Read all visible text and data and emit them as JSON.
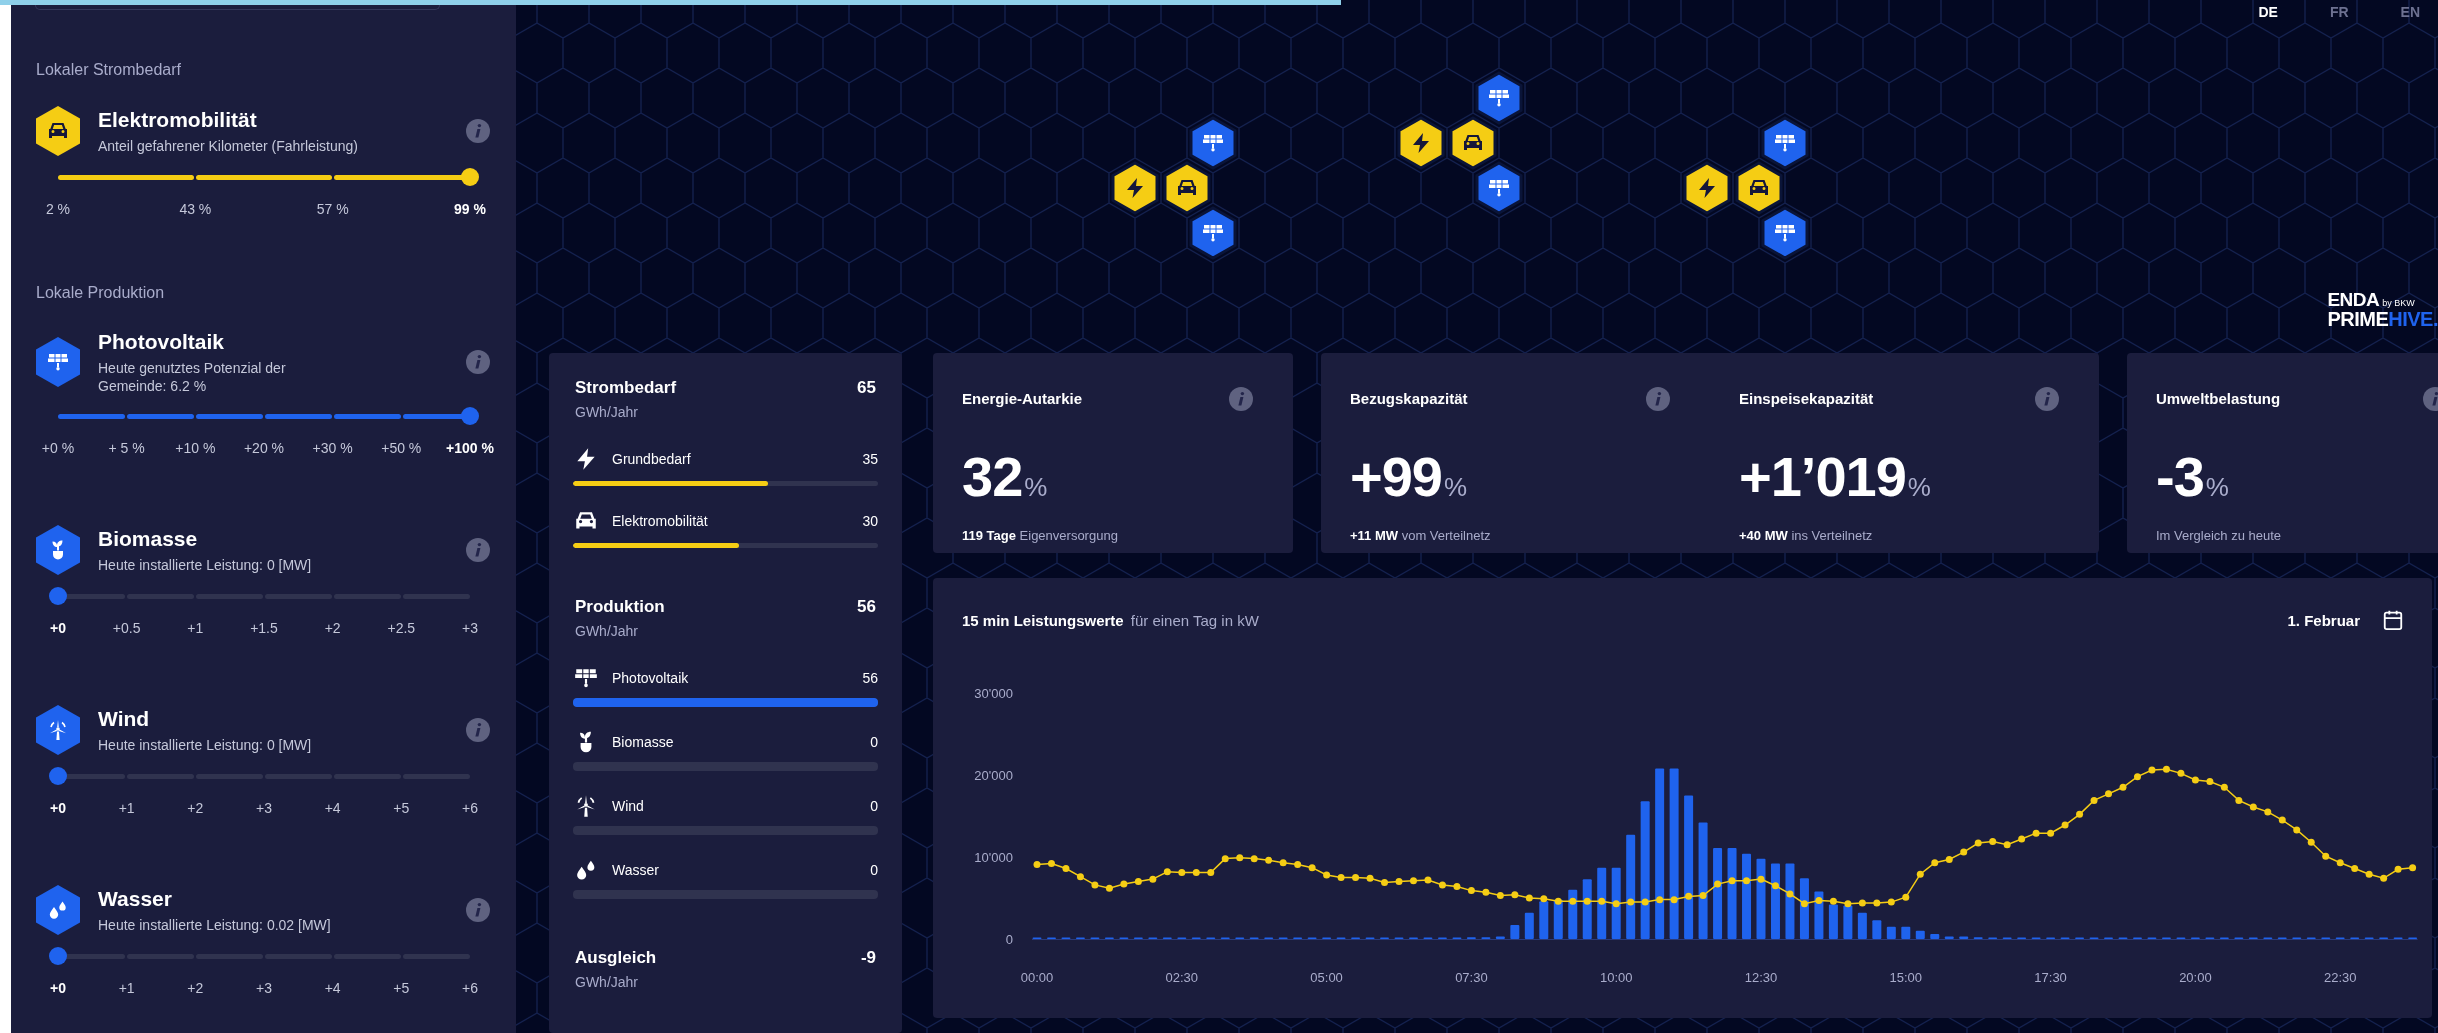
{
  "loading_bar": {
    "level": 0.55
  },
  "sidebar": {
    "sections": [
      {
        "kind": "demand",
        "heading": "Lokaler Strombedarf",
        "controls": [
          {
            "kind": "car",
            "title": "Elektromobilität",
            "subtitle": "Anteil gefahrener Kilometer (Fahrleistung)",
            "level": 1,
            "ticks": [
              {
                "label": "2 %",
                "selected": false
              },
              {
                "label": "43 %",
                "selected": false
              },
              {
                "label": "57 %",
                "selected": false
              },
              {
                "label": "99 %",
                "selected": true
              }
            ]
          }
        ]
      },
      {
        "kind": "production",
        "heading": "Lokale Produktion",
        "controls": [
          {
            "kind": "solar",
            "title": "Photovoltaik",
            "subtitle": "Heute genutztes Potenzial der\nGemeinde: 6.2 %",
            "level": 1,
            "ticks": [
              {
                "label": "+0 %",
                "selected": false
              },
              {
                "label": "+ 5 %",
                "selected": false
              },
              {
                "label": "+10 %",
                "selected": false
              },
              {
                "label": "+20 %",
                "selected": false
              },
              {
                "label": "+30 %",
                "selected": false
              },
              {
                "label": "+50 %",
                "selected": false
              },
              {
                "label": "+100 %",
                "selected": true
              }
            ]
          },
          {
            "kind": "sprout",
            "title": "Biomasse",
            "subtitle": "Heute installierte Leistung: 0 [MW]",
            "level": 0,
            "ticks": [
              {
                "label": "+0",
                "selected": true
              },
              {
                "label": "+0.5",
                "selected": false
              },
              {
                "label": "+1",
                "selected": false
              },
              {
                "label": "+1.5",
                "selected": false
              },
              {
                "label": "+2",
                "selected": false
              },
              {
                "label": "+2.5",
                "selected": false
              },
              {
                "label": "+3",
                "selected": false
              }
            ]
          },
          {
            "kind": "turbine",
            "title": "Wind",
            "subtitle": "Heute installierte Leistung: 0 [MW]",
            "level": 0,
            "ticks": [
              {
                "label": "+0",
                "selected": true
              },
              {
                "label": "+1",
                "selected": false
              },
              {
                "label": "+2",
                "selected": false
              },
              {
                "label": "+3",
                "selected": false
              },
              {
                "label": "+4",
                "selected": false
              },
              {
                "label": "+5",
                "selected": false
              },
              {
                "label": "+6",
                "selected": false
              }
            ]
          },
          {
            "kind": "drops",
            "title": "Wasser",
            "subtitle": "Heute installierte Leistung: 0.02 [MW]",
            "level": 0,
            "ticks": [
              {
                "label": "+0",
                "selected": true
              },
              {
                "label": "+1",
                "selected": false
              },
              {
                "label": "+2",
                "selected": false
              },
              {
                "label": "+3",
                "selected": false
              },
              {
                "label": "+4",
                "selected": false
              },
              {
                "label": "+5",
                "selected": false
              },
              {
                "label": "+6",
                "selected": false
              }
            ]
          }
        ]
      }
    ]
  },
  "map": {
    "languages": [
      {
        "code": "DE",
        "selected": true
      },
      {
        "code": "FR",
        "selected": false
      },
      {
        "code": "EN",
        "selected": false
      }
    ],
    "clusters": [
      {
        "tiles": [
          {
            "kind": "bolt"
          },
          {
            "kind": "car"
          },
          {
            "kind": "solar"
          },
          {
            "kind": "solar"
          }
        ]
      },
      {
        "tiles": [
          {
            "kind": "bolt"
          },
          {
            "kind": "car"
          },
          {
            "kind": "solar"
          },
          {
            "kind": "solar"
          }
        ]
      },
      {
        "tiles": [
          {
            "kind": "bolt"
          },
          {
            "kind": "car"
          },
          {
            "kind": "solar"
          },
          {
            "kind": "solar"
          }
        ]
      }
    ],
    "logo": {
      "name": "ENDA",
      "tagline": "by BKW",
      "product": "PRIME",
      "product_accent": "HIVE."
    }
  },
  "energy_panel": {
    "groups": [
      {
        "kind": "demand",
        "title": "Strombedarf",
        "total": "65",
        "unit": "GWh/Jahr",
        "items": [
          {
            "kind": "bolt",
            "label": "Grundbedarf",
            "value": "35",
            "level": 0.64
          },
          {
            "kind": "car",
            "label": "Elektromobilität",
            "value": "30",
            "level": 0.545
          }
        ]
      },
      {
        "kind": "production",
        "title": "Produktion",
        "total": "56",
        "unit": "GWh/Jahr",
        "items": [
          {
            "kind": "solar",
            "label": "Photovoltaik",
            "value": "56",
            "level": 1
          },
          {
            "kind": "sprout",
            "label": "Biomasse",
            "value": "0",
            "level": 0
          },
          {
            "kind": "turbine",
            "label": "Wind",
            "value": "0",
            "level": 0
          },
          {
            "kind": "drops",
            "label": "Wasser",
            "value": "0",
            "level": 0
          }
        ]
      },
      {
        "kind": "balance",
        "title": "Ausgleich",
        "total": "-9",
        "unit": "GWh/Jahr"
      }
    ]
  },
  "kpi_cards": [
    {
      "sections": [
        {
          "title": "Energie-Autarkie",
          "value": "32",
          "unit": "%",
          "note": "**119 Tage** Eigenversorgung"
        }
      ]
    },
    {
      "sections": [
        {
          "title": "Bezugskapazität",
          "value": "+99",
          "unit": "%",
          "note": "**+11 MW** vom Verteilnetz"
        },
        {
          "title": "Einspeisekapazität",
          "value": "+1’019",
          "unit": "%",
          "note": "**+40 MW** ins Verteilnetz"
        }
      ]
    },
    {
      "sections": [
        {
          "title": "Umweltbelastung",
          "value": "-3",
          "unit": "%",
          "note": "Im Vergleich zu heute"
        }
      ]
    }
  ],
  "power_chart": {
    "title": "15 min Leistungswerte",
    "subtitle": "für einen Tag in kW",
    "date": "1. Februar",
    "chart_data": {
      "type": "bar",
      "ylim": [
        0,
        30000
      ],
      "xlim": [
        0,
        1425
      ],
      "x": [
        0,
        15,
        30,
        45,
        60,
        75,
        90,
        105,
        120,
        135,
        150,
        165,
        180,
        195,
        210,
        225,
        240,
        255,
        270,
        285,
        300,
        315,
        330,
        345,
        360,
        375,
        390,
        405,
        420,
        435,
        450,
        465,
        480,
        495,
        510,
        525,
        540,
        555,
        570,
        585,
        600,
        615,
        630,
        645,
        660,
        675,
        690,
        705,
        720,
        735,
        750,
        765,
        780,
        795,
        810,
        825,
        840,
        855,
        870,
        885,
        900,
        915,
        930,
        945,
        960,
        975,
        990,
        1005,
        1020,
        1035,
        1050,
        1065,
        1080,
        1095,
        1110,
        1125,
        1140,
        1155,
        1170,
        1185,
        1200,
        1215,
        1230,
        1245,
        1260,
        1275,
        1290,
        1305,
        1320,
        1335,
        1350,
        1365,
        1380,
        1395,
        1410,
        1425
      ],
      "xticks": [
        {
          "value": 0,
          "label": "00:00"
        },
        {
          "value": 150,
          "label": "02:30"
        },
        {
          "value": 300,
          "label": "05:00"
        },
        {
          "value": 450,
          "label": "07:30"
        },
        {
          "value": 600,
          "label": "10:00"
        },
        {
          "value": 750,
          "label": "12:30"
        },
        {
          "value": 900,
          "label": "15:00"
        },
        {
          "value": 1050,
          "label": "17:30"
        },
        {
          "value": 1200,
          "label": "20:00"
        },
        {
          "value": 1350,
          "label": "22:30"
        }
      ],
      "yticks": [
        {
          "value": 0,
          "label": "0"
        },
        {
          "value": 10000,
          "label": "10'000"
        },
        {
          "value": 20000,
          "label": "20'000"
        },
        {
          "value": 30000,
          "label": "30'000"
        }
      ],
      "series": [
        {
          "type": "bar",
          "color": "#1f63ee",
          "values": [
            0,
            0,
            0,
            0,
            0,
            0,
            0,
            0,
            0,
            0,
            0,
            0,
            0,
            0,
            0,
            0,
            0,
            0,
            0,
            0,
            0,
            0,
            0,
            0,
            0,
            0,
            0,
            0,
            0,
            100,
            200,
            200,
            300,
            1700,
            3200,
            4600,
            4800,
            6000,
            7300,
            8700,
            8700,
            12700,
            16800,
            20800,
            20800,
            17500,
            14200,
            11100,
            11100,
            10400,
            9800,
            9200,
            9200,
            7400,
            5800,
            4200,
            4100,
            3200,
            2300,
            1500,
            1500,
            1000,
            600,
            300,
            300,
            200,
            100,
            0,
            0,
            0,
            0,
            0,
            0,
            0,
            0,
            0,
            0,
            0,
            0,
            0,
            0,
            0,
            0,
            0,
            0,
            0,
            0,
            0,
            0,
            0,
            0,
            0,
            0,
            0,
            0,
            0
          ]
        },
        {
          "type": "line",
          "marker": "circle",
          "color": "#f5cd14",
          "values": [
            9100,
            9200,
            8600,
            7600,
            6600,
            6200,
            6700,
            7000,
            7300,
            8200,
            8100,
            8100,
            8100,
            9800,
            9900,
            9800,
            9600,
            9300,
            9100,
            8700,
            7800,
            7500,
            7500,
            7400,
            6900,
            7000,
            7100,
            7200,
            6600,
            6400,
            5900,
            5700,
            5300,
            5400,
            5000,
            4900,
            4600,
            4600,
            4600,
            4600,
            4300,
            4500,
            4500,
            4800,
            4800,
            5200,
            5300,
            6700,
            7100,
            7100,
            7300,
            6500,
            5500,
            4300,
            4700,
            4600,
            4300,
            4400,
            4400,
            4500,
            5100,
            7900,
            9300,
            9700,
            10600,
            11700,
            11900,
            11500,
            12200,
            12900,
            12900,
            13900,
            15200,
            16900,
            17700,
            18500,
            19800,
            20600,
            20700,
            20200,
            19400,
            19200,
            18500,
            16900,
            16100,
            15500,
            14500,
            13300,
            11800,
            10100,
            9300,
            8600,
            7900,
            7400,
            8500,
            8700
          ]
        }
      ]
    }
  }
}
